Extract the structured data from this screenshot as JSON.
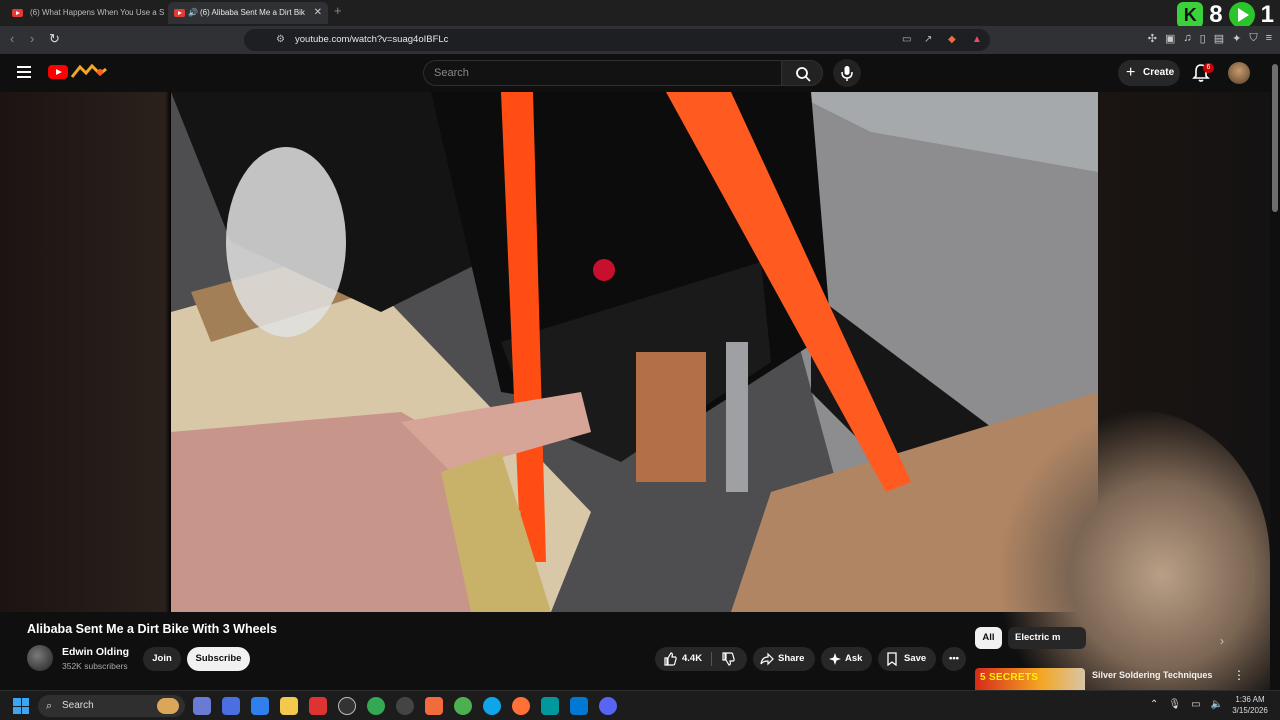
{
  "browser": {
    "tabs": [
      {
        "title": "(6) What Happens When You Use a S"
      },
      {
        "title": "(6) Alibaba Sent Me a Dirt Bik"
      }
    ],
    "url": "youtube.com/watch?v=suag4oIBFLc",
    "badges": {
      "k_count": "8",
      "play_count": "1"
    }
  },
  "yt_header": {
    "search_placeholder": "Search",
    "create_label": "Create",
    "notifications_count": "6"
  },
  "video": {
    "title": "Alibaba Sent Me a Dirt Bike With 3 Wheels",
    "channel_name": "Edwin Olding",
    "subscribers": "352K subscribers",
    "join_label": "Join",
    "subscribe_label": "Subscribe",
    "likes": "4.4K",
    "share_label": "Share",
    "ask_label": "Ask",
    "save_label": "Save"
  },
  "sidebar": {
    "chips": [
      "All",
      "Electric m"
    ],
    "rec_thumb_label": "5 SECRETS",
    "rec_title": "Silver Soldering Techniques"
  },
  "taskbar": {
    "search_label": "Search",
    "time": "1:36 AM",
    "date": "3/15/2026"
  },
  "colors": {
    "yt_red": "#ff0000",
    "strap_orange": "#ff4d14",
    "bg": "#0f0f0f"
  }
}
